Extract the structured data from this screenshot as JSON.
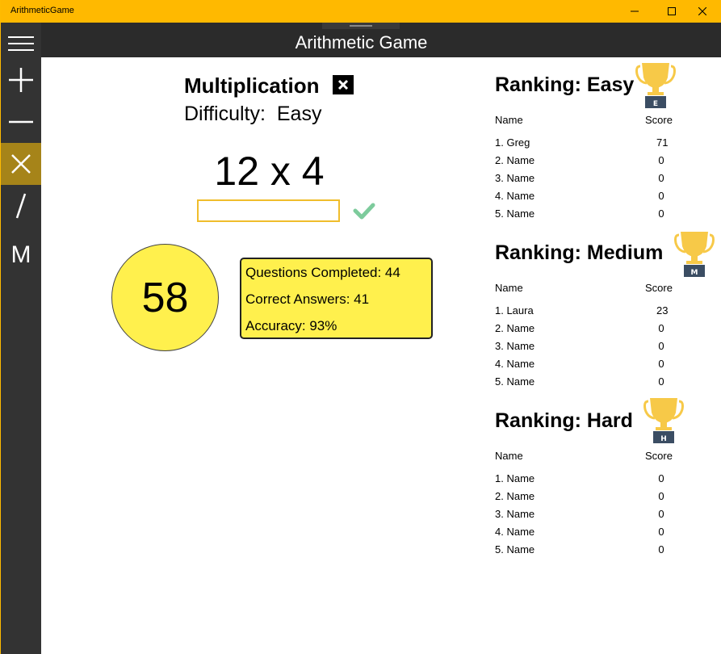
{
  "window": {
    "title": "ArithmeticGame"
  },
  "header": {
    "title": "Arithmetic Game"
  },
  "sidebar": {
    "items": [
      {
        "name": "menu",
        "glyph": "≡"
      },
      {
        "name": "addition",
        "glyph": "+"
      },
      {
        "name": "subtraction",
        "glyph": "—"
      },
      {
        "name": "multiplication",
        "glyph": "×"
      },
      {
        "name": "division",
        "glyph": "/"
      },
      {
        "name": "mixed",
        "glyph": "M"
      }
    ],
    "selected": "multiplication"
  },
  "game": {
    "operation": "Multiplication",
    "difficulty_label": "Difficulty:",
    "difficulty_value": "Easy",
    "problem": "12 x 4",
    "answer_value": "",
    "timer": "58",
    "stats": {
      "questions_completed": "Questions Completed: 44",
      "correct_answers": "Correct Answers: 41",
      "accuracy": "Accuracy: 93%"
    }
  },
  "rankings": [
    {
      "title": "Ranking: Easy",
      "badge": "E",
      "name_header": "Name",
      "score_header": "Score",
      "rows": [
        {
          "name": "1. Greg",
          "score": "71"
        },
        {
          "name": "2. Name",
          "score": "0"
        },
        {
          "name": "3. Name",
          "score": "0"
        },
        {
          "name": "4. Name",
          "score": "0"
        },
        {
          "name": "5. Name",
          "score": "0"
        }
      ]
    },
    {
      "title": "Ranking: Medium",
      "badge": "M",
      "name_header": "Name",
      "score_header": "Score",
      "rows": [
        {
          "name": "1. Laura",
          "score": "23"
        },
        {
          "name": "2. Name",
          "score": "0"
        },
        {
          "name": "3. Name",
          "score": "0"
        },
        {
          "name": "4. Name",
          "score": "0"
        },
        {
          "name": "5. Name",
          "score": "0"
        }
      ]
    },
    {
      "title": "Ranking: Hard",
      "badge": "H",
      "name_header": "Name",
      "score_header": "Score",
      "rows": [
        {
          "name": "1. Name",
          "score": "0"
        },
        {
          "name": "2. Name",
          "score": "0"
        },
        {
          "name": "3. Name",
          "score": "0"
        },
        {
          "name": "4. Name",
          "score": "0"
        },
        {
          "name": "5. Name",
          "score": "0"
        }
      ]
    }
  ],
  "colors": {
    "titlebar": "#ffb900",
    "header": "#2b2b2b",
    "sidebar": "#333333",
    "sidebar_selected": "#a68419",
    "highlight_yellow": "#fff04d",
    "check_green": "#7dcb9c",
    "trophy_gold": "#f7c948"
  },
  "icons": {
    "minimize": "minimize-icon",
    "maximize": "maximize-icon",
    "close": "close-icon",
    "check": "check-icon",
    "trophy": "trophy-icon"
  }
}
